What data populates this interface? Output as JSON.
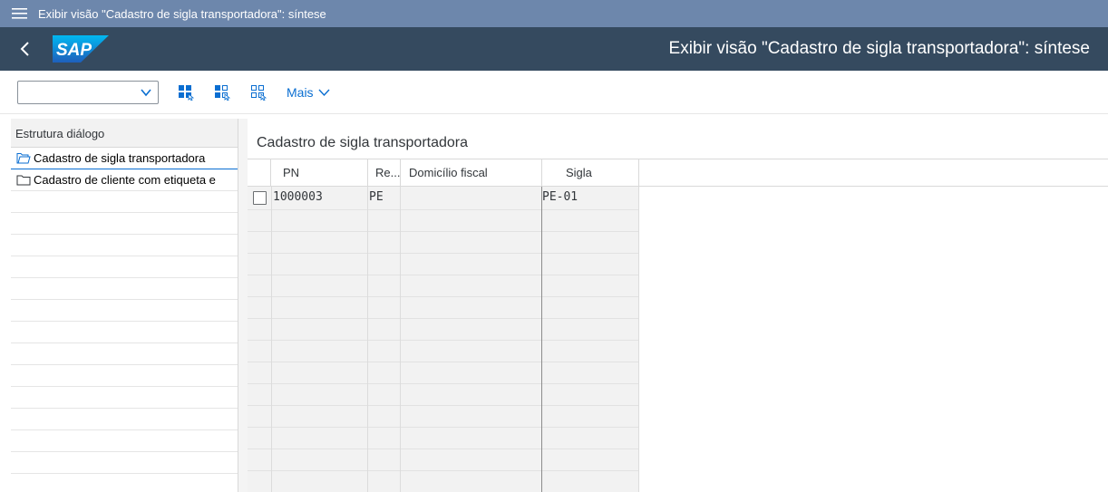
{
  "window": {
    "title": "Exibir visão \"Cadastro de sigla transportadora\": síntese"
  },
  "shell": {
    "title": "Exibir visão \"Cadastro de sigla transportadora\": síntese",
    "logo_text": "SAP",
    "brand_color": "#0a6ed1",
    "bar_color": "#354a5f"
  },
  "toolbar": {
    "combo_value": "",
    "more_label": "Mais",
    "icons": [
      "select-all-icon",
      "select-block-icon",
      "deselect-all-icon"
    ]
  },
  "dialog_structure": {
    "header": "Estrutura diálogo",
    "items": [
      {
        "label": "Cadastro de sigla transportadora",
        "icon": "open-folder-icon",
        "selected": true
      },
      {
        "label": "Cadastro de cliente com etiqueta e",
        "icon": "folder-icon",
        "selected": false
      }
    ]
  },
  "table": {
    "title": "Cadastro de sigla transportadora",
    "columns": [
      "PN",
      "Re...",
      "Domicílio fiscal",
      "Sigla"
    ],
    "rows": [
      {
        "pn": "1000003",
        "re": "PE",
        "domicilio": "",
        "sigla": "PE-01"
      }
    ]
  }
}
